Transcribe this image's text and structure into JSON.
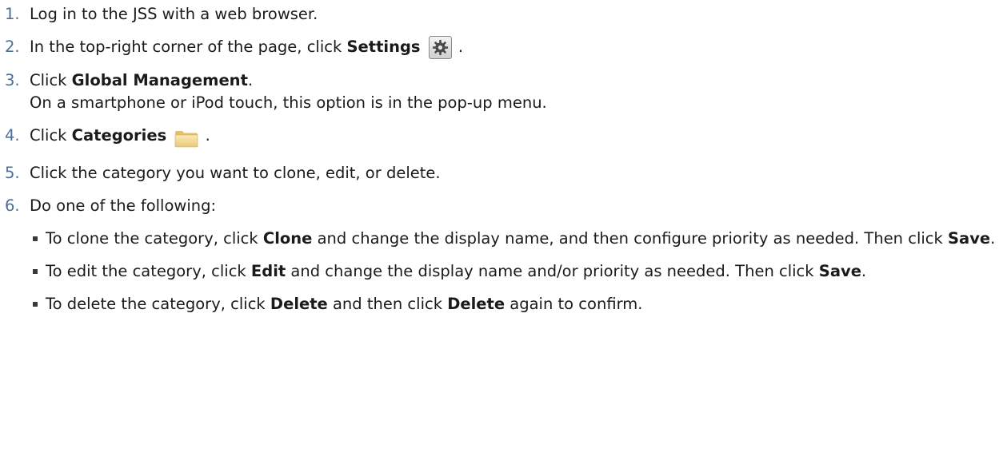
{
  "steps": [
    {
      "num": "1.",
      "text": "Log in to the JSS with a web browser."
    },
    {
      "num": "2.",
      "pre": "In the top-right corner of the page, click ",
      "bold": "Settings",
      "post": " ."
    },
    {
      "num": "3.",
      "pre": "Click ",
      "bold": "Global Management",
      "post": ".",
      "line2": "On a smartphone or iPod touch, this option is in the pop-up menu."
    },
    {
      "num": "4.",
      "pre": "Click ",
      "bold": "Categories",
      "post": " ."
    },
    {
      "num": "5.",
      "text": "Click the category you want to clone, edit, or delete."
    },
    {
      "num": "6.",
      "text": "Do one of the following:"
    }
  ],
  "subs": [
    {
      "a": "To clone the category, click ",
      "b1": "Clone",
      "c": " and change the display name, and then configure priority as needed. Then click ",
      "b2": "Save",
      "d": "."
    },
    {
      "a": "To edit the category, click ",
      "b1": "Edit",
      "c": " and change the display name and/or priority as needed. Then click ",
      "b2": "Save",
      "d": "."
    },
    {
      "a": "To delete the category, click ",
      "b1": "Delete",
      "c": " and then click ",
      "b2": "Delete",
      "d": " again to confirm."
    }
  ]
}
